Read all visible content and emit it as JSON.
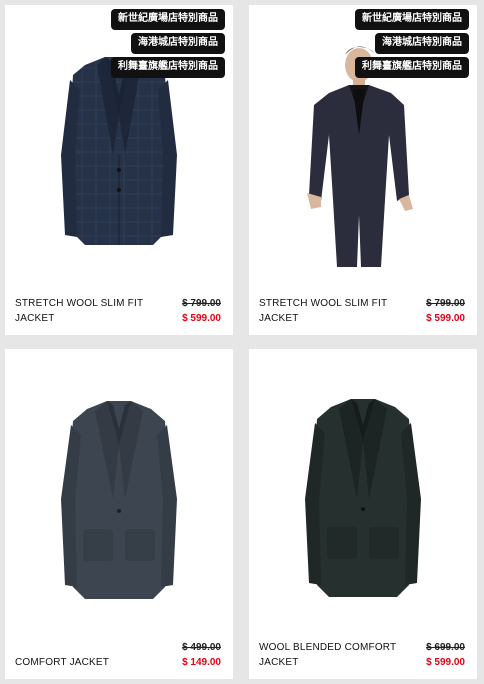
{
  "colors": {
    "background": "#e6e6e6",
    "card": "#ffffff",
    "badge_bg": "#111111",
    "sale_price": "#e60012"
  },
  "products": [
    {
      "badges": [
        "新世紀廣場店特別商品",
        "海港城店特別商品",
        "利舞臺旗艦店特別商品"
      ],
      "name": "STRETCH WOOL SLIM FIT JACKET",
      "old_price": "$ 799.00",
      "new_price": "$ 599.00",
      "image": "navy-check-jacket-icon"
    },
    {
      "badges": [
        "新世紀廣場店特別商品",
        "海港城店特別商品",
        "利舞臺旗艦店特別商品"
      ],
      "name": "STRETCH WOOL SLIM FIT JACKET",
      "old_price": "$ 799.00",
      "new_price": "$ 599.00",
      "image": "model-in-suit-icon"
    },
    {
      "badges": [],
      "name": "COMFORT JACKET",
      "old_price": "$ 499.00",
      "new_price": "$ 149.00",
      "image": "grey-comfort-jacket-icon"
    },
    {
      "badges": [],
      "name": "WOOL BLENDED COMFORT JACKET",
      "old_price": "$ 699.00",
      "new_price": "$ 599.00",
      "image": "dark-wool-jacket-icon"
    }
  ]
}
